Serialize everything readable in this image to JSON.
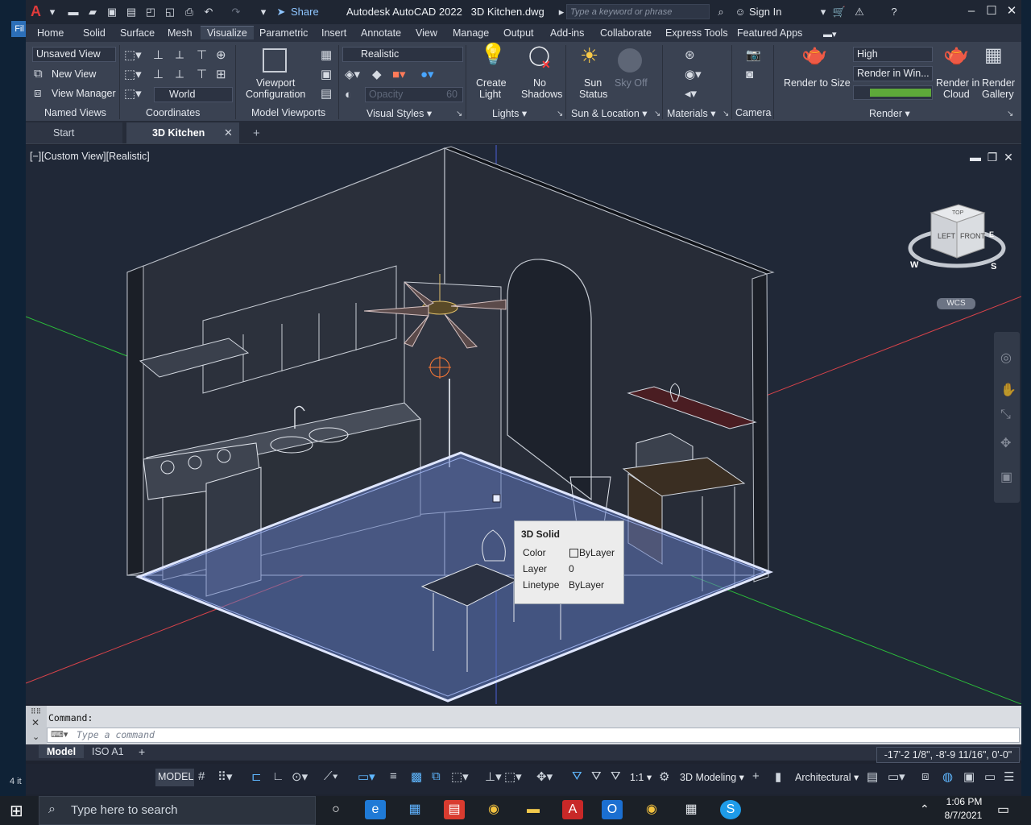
{
  "desktop": {
    "left_label": "Fil",
    "left_bottom": "4 it"
  },
  "titlebar": {
    "app_logo": "A",
    "share": "Share",
    "title": "Autodesk AutoCAD 2022",
    "filename": "3D Kitchen.dwg",
    "search_placeholder": "Type a keyword or phrase",
    "sign_in": "Sign In"
  },
  "ribbon_tabs": [
    "Home",
    "Solid",
    "Surface",
    "Mesh",
    "Visualize",
    "Parametric",
    "Insert",
    "Annotate",
    "View",
    "Manage",
    "Output",
    "Add-ins",
    "Collaborate",
    "Express Tools",
    "Featured Apps"
  ],
  "active_tab": "Visualize",
  "ribbon": {
    "named_views": {
      "dropdown": "Unsaved View",
      "new_view": "New View",
      "view_manager": "View Manager",
      "title": "Named Views"
    },
    "coordinates": {
      "ucs": "World",
      "title": "Coordinates"
    },
    "model_viewports": {
      "button": "Viewport",
      "button2": "Configuration",
      "title": "Model Viewports"
    },
    "visual_styles": {
      "style": "Realistic",
      "opacity_label": "Opacity",
      "opacity_value": "60",
      "title": "Visual Styles"
    },
    "lights": {
      "create_light": "Create",
      "create_light2": "Light",
      "no_shadows": "No",
      "no_shadows2": "Shadows",
      "title": "Lights"
    },
    "sun_location": {
      "sun_status": "Sun",
      "sun_status2": "Status",
      "sky_off": "Sky Off",
      "title": "Sun & Location"
    },
    "materials": {
      "title": "Materials"
    },
    "camera": {
      "title": "Camera"
    },
    "render": {
      "render_to_size": "Render to Size",
      "quality": "High",
      "render_in": "Render in Win...",
      "render_cloud": "Render in",
      "render_cloud2": "Cloud",
      "render_gallery": "Render",
      "render_gallery2": "Gallery",
      "title": "Render"
    }
  },
  "file_tabs": {
    "start": "Start",
    "current": "3D Kitchen"
  },
  "viewport": {
    "label": "[−][Custom View][Realistic]"
  },
  "viewcube": {
    "left": "LEFT",
    "front": "FRONT",
    "top": "TOP",
    "wcs": "WCS",
    "w": "W",
    "s": "S",
    "e": "E"
  },
  "tooltip": {
    "title": "3D Solid",
    "rows": [
      {
        "k": "Color",
        "v": "ByLayer"
      },
      {
        "k": "Layer",
        "v": "0"
      },
      {
        "k": "Linetype",
        "v": "ByLayer"
      }
    ]
  },
  "command": {
    "history": "Command:",
    "placeholder": "Type a command"
  },
  "layout_tabs": {
    "model": "Model",
    "iso": "ISO A1"
  },
  "coords": "-17'-2 1/8\", -8'-9 11/16\", 0'-0\"",
  "statusbar": {
    "model": "MODEL",
    "scale": "1:1",
    "workspace": "3D Modeling",
    "units": "Architectural"
  },
  "taskbar": {
    "search": "Type here to search",
    "time": "1:06 PM",
    "date": "8/7/2021"
  }
}
